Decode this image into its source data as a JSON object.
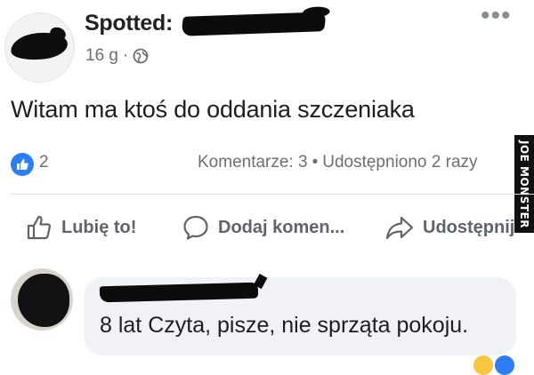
{
  "post": {
    "page_name_prefix": "Spotted:",
    "time": "16 g",
    "meta_separator": "·",
    "more_icon": "•••",
    "text": "Witam ma ktoś do oddania szczeniaka"
  },
  "stats": {
    "like_count": "2",
    "comments": "Komentarze: 3",
    "separator": "•",
    "shares": "Udostępniono 2 razy"
  },
  "actions": {
    "like_label": "Lubię to!",
    "comment_label": "Dodaj komen...",
    "share_label": "Udostępnij"
  },
  "comment": {
    "text": "8 lat Czyta, pisze, nie sprząta pokoju."
  },
  "watermark": {
    "text": "JOE MONSTER"
  },
  "colors": {
    "like_blue": "#2d7df6",
    "meta_gray": "#6b6e73",
    "bubble_bg": "#f1f2f6"
  },
  "icons": {
    "globe": "globe-icon",
    "thumb": "thumbs-up-icon",
    "comment": "speech-bubble-icon",
    "share": "share-arrow-icon"
  }
}
